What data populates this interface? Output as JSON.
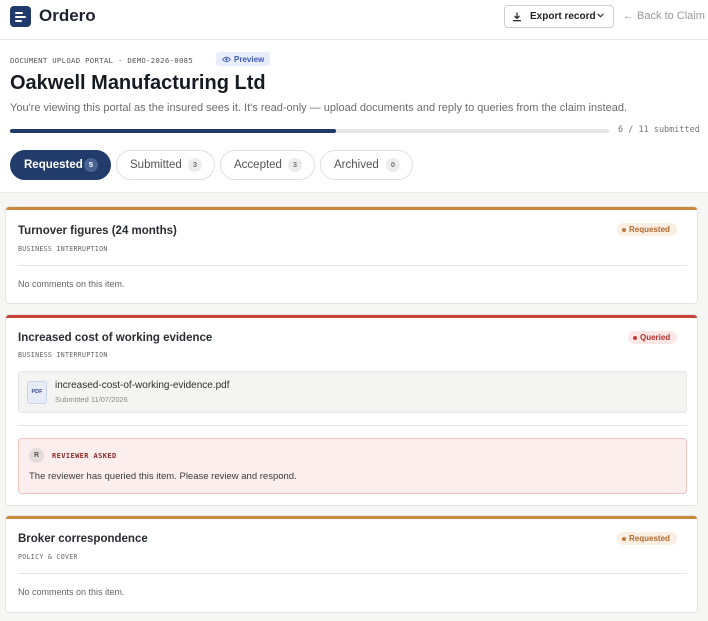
{
  "app": {
    "name": "Ordero",
    "export_label": "Export record",
    "back_label": "← Back to Claim"
  },
  "header": {
    "portal_tag": "DOCUMENT UPLOAD PORTAL · DEMO-2026-0085",
    "preview_label": "Preview",
    "title": "Oakwell Manufacturing Ltd",
    "subtitle": "You're viewing this portal as the insured sees it. It's read-only — upload documents and reply to queries from the claim instead.",
    "progress_fraction": 0.545,
    "progress_text": "6 / 11 submitted"
  },
  "tabs": [
    {
      "label": "Requested",
      "count": "5",
      "active": true
    },
    {
      "label": "Submitted",
      "count": "3",
      "active": false
    },
    {
      "label": "Accepted",
      "count": "3",
      "active": false
    },
    {
      "label": "Archived",
      "count": "0",
      "active": false
    }
  ],
  "cards": [
    {
      "title": "Turnover figures (24 months)",
      "category": "BUSINESS INTERRUPTION",
      "status": "Requested",
      "comment": "No comments on this item."
    },
    {
      "title": "Increased cost of working evidence",
      "category": "BUSINESS INTERRUPTION",
      "status": "Queried",
      "file": {
        "type": "PDF",
        "name": "increased-cost-of-working-evidence.pdf",
        "date": "Submitted 11/07/2026"
      },
      "query": {
        "avatar": "R",
        "label": "REVIEWER ASKED",
        "text": "The reviewer has queried this item. Please review and respond."
      }
    },
    {
      "title": "Broker correspondence",
      "category": "POLICY & COVER",
      "status": "Requested",
      "comment": "No comments on this item."
    }
  ],
  "colors": {
    "brand": "#1f3a6b",
    "requested_accent": "#c98a3d",
    "queried_accent": "#c8433a"
  },
  "icons": {
    "logo": "menu-lines-icon",
    "export": "download-icon",
    "preview": "eye-icon",
    "file": "pdf-file-icon"
  }
}
